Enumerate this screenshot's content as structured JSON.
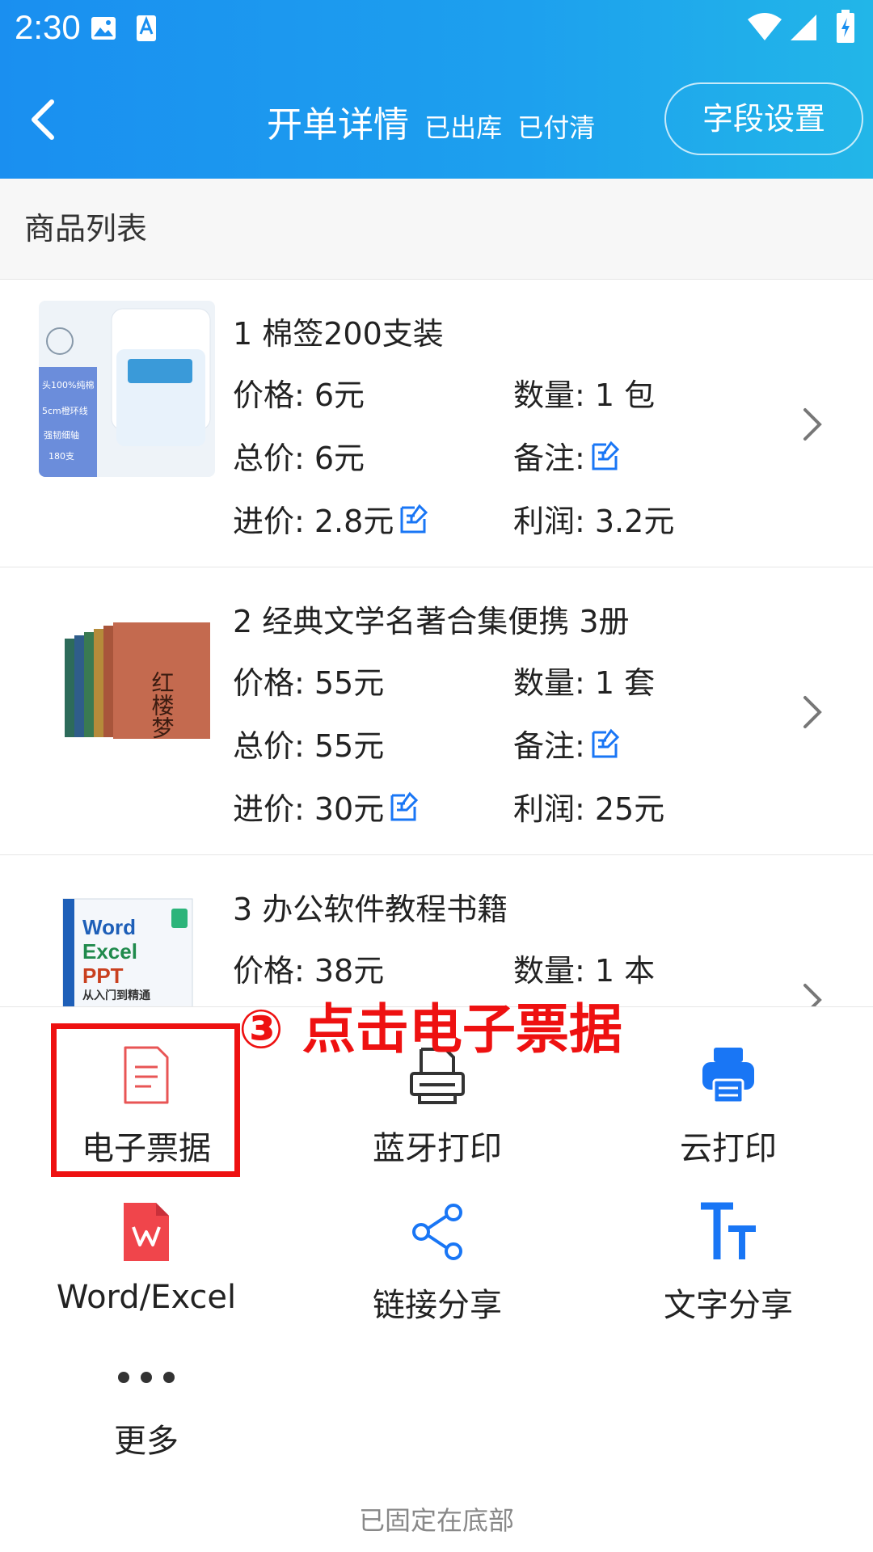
{
  "status_bar": {
    "time": "2:30"
  },
  "header": {
    "back_icon": "chevron-left-icon",
    "title": "开单详情",
    "status_1": "已出库",
    "status_2": "已付清",
    "field_settings": "字段设置"
  },
  "section": {
    "title": "商品列表"
  },
  "items": [
    {
      "name": "1 棉签200支装",
      "price": "价格: 6元",
      "qty": "数量: 1 包",
      "total": "总价: 6元",
      "note": "备注:",
      "cost": "进价: 2.8元",
      "profit": "利润: 3.2元",
      "thumb_text_1": "头100%纯棉",
      "thumb_text_2": "5cm橙环线",
      "thumb_text_3": "强韧细轴",
      "thumb_text_4": "180支"
    },
    {
      "name": "2 经典文学名著合集便携 3册",
      "price": "价格: 55元",
      "qty": "数量: 1 套",
      "total": "总价: 55元",
      "note": "备注:",
      "cost": "进价: 30元",
      "profit": "利润: 25元",
      "thumb_text_1": "红楼梦"
    },
    {
      "name": "3 办公软件教程书籍",
      "price": "价格: 38元",
      "qty": "数量: 1 本",
      "thumb_text_1": "Word",
      "thumb_text_2": "Excel",
      "thumb_text_3": "PPT",
      "thumb_text_4": "从入门到精通"
    }
  ],
  "actions": [
    {
      "label": "电子票据",
      "icon": "document-icon"
    },
    {
      "label": "蓝牙打印",
      "icon": "printer-outline-icon"
    },
    {
      "label": "云打印",
      "icon": "cloud-printer-icon"
    },
    {
      "label": "Word/Excel",
      "icon": "wps-file-icon"
    },
    {
      "label": "链接分享",
      "icon": "share-icon"
    },
    {
      "label": "文字分享",
      "icon": "text-tt-icon"
    },
    {
      "label": "更多",
      "icon": "more-dots-icon"
    }
  ],
  "pinned_text": "已固定在底部",
  "annotation": {
    "text": "③ 点击电子票据"
  },
  "colors": {
    "header": "#1a8ff0",
    "accent": "#1976f5",
    "annotation": "#ee1111"
  }
}
